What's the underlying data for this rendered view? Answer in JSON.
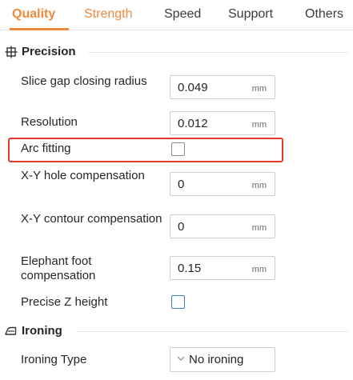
{
  "tabs": [
    {
      "label": "Quality"
    },
    {
      "label": "Strength"
    },
    {
      "label": "Speed"
    },
    {
      "label": "Support"
    },
    {
      "label": "Others"
    }
  ],
  "sections": {
    "precision": {
      "title": "Precision",
      "icon": "precision-icon"
    },
    "ironing": {
      "title": "Ironing",
      "icon": "ironing-icon"
    }
  },
  "settings": {
    "slice_gap": {
      "label": "Slice gap closing radius",
      "value": "0.049",
      "unit": "mm"
    },
    "resolution": {
      "label": "Resolution",
      "value": "0.012",
      "unit": "mm"
    },
    "arc_fitting": {
      "label": "Arc fitting",
      "checked": false
    },
    "xy_hole": {
      "label": "X-Y hole compensation",
      "value": "0",
      "unit": "mm"
    },
    "xy_contour": {
      "label": "X-Y contour compensation",
      "value": "0",
      "unit": "mm"
    },
    "elephant_foot": {
      "label": "Elephant foot compensation",
      "value": "0.15",
      "unit": "mm"
    },
    "precise_z": {
      "label": "Precise Z height",
      "checked": false
    },
    "ironing_type": {
      "label": "Ironing Type",
      "value": "No ironing"
    }
  },
  "colors": {
    "accent": "#f0883c",
    "highlight": "#e8382b",
    "checkbox_blue": "#3b7be0"
  }
}
